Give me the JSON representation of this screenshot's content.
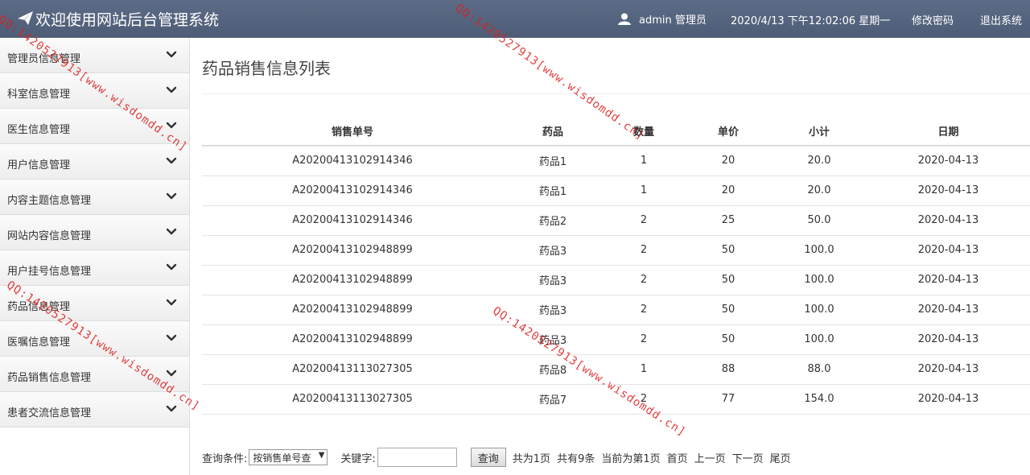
{
  "header": {
    "title": "欢迎使用网站后台管理系统",
    "user": "admin 管理员",
    "datetime": "2020/4/13 下午12:02:06 星期一",
    "change_password": "修改密码",
    "logout": "退出系统"
  },
  "sidebar": {
    "items": [
      {
        "label": "管理员信息管理"
      },
      {
        "label": "科室信息管理"
      },
      {
        "label": "医生信息管理"
      },
      {
        "label": "用户信息管理"
      },
      {
        "label": "内容主题信息管理"
      },
      {
        "label": "网站内容信息管理"
      },
      {
        "label": "用户挂号信息管理"
      },
      {
        "label": "药品信息管理"
      },
      {
        "label": "医嘱信息管理"
      },
      {
        "label": "药品销售信息管理"
      },
      {
        "label": "患者交流信息管理"
      }
    ]
  },
  "main": {
    "title": "药品销售信息列表",
    "columns": [
      "销售单号",
      "药品",
      "数量",
      "单价",
      "小计",
      "日期"
    ],
    "rows": [
      [
        "A20200413102914346",
        "药品1",
        "1",
        "20",
        "20.0",
        "2020-04-13"
      ],
      [
        "A20200413102914346",
        "药品1",
        "1",
        "20",
        "20.0",
        "2020-04-13"
      ],
      [
        "A20200413102914346",
        "药品2",
        "2",
        "25",
        "50.0",
        "2020-04-13"
      ],
      [
        "A20200413102948899",
        "药品3",
        "2",
        "50",
        "100.0",
        "2020-04-13"
      ],
      [
        "A20200413102948899",
        "药品3",
        "2",
        "50",
        "100.0",
        "2020-04-13"
      ],
      [
        "A20200413102948899",
        "药品3",
        "2",
        "50",
        "100.0",
        "2020-04-13"
      ],
      [
        "A20200413102948899",
        "药品3",
        "2",
        "50",
        "100.0",
        "2020-04-13"
      ],
      [
        "A20200413113027305",
        "药品8",
        "1",
        "88",
        "88.0",
        "2020-04-13"
      ],
      [
        "A20200413113027305",
        "药品7",
        "2",
        "77",
        "154.0",
        "2020-04-13"
      ]
    ]
  },
  "search": {
    "condition_label": "查询条件:",
    "condition_value": "按销售单号查",
    "keyword_label": "关键字:",
    "keyword_value": "",
    "button": "查询"
  },
  "pager": {
    "total_pages": "共为1页",
    "total_count": "共有9条",
    "current": "当前为第1页",
    "first": "首页",
    "prev": "上一页",
    "next": "下一页",
    "last": "尾页"
  },
  "watermark": "QQ:1420527913[www.wisdomdd.cn]",
  "colors": {
    "header_bg": "#56657f",
    "watermark": "#dc1e1e"
  }
}
